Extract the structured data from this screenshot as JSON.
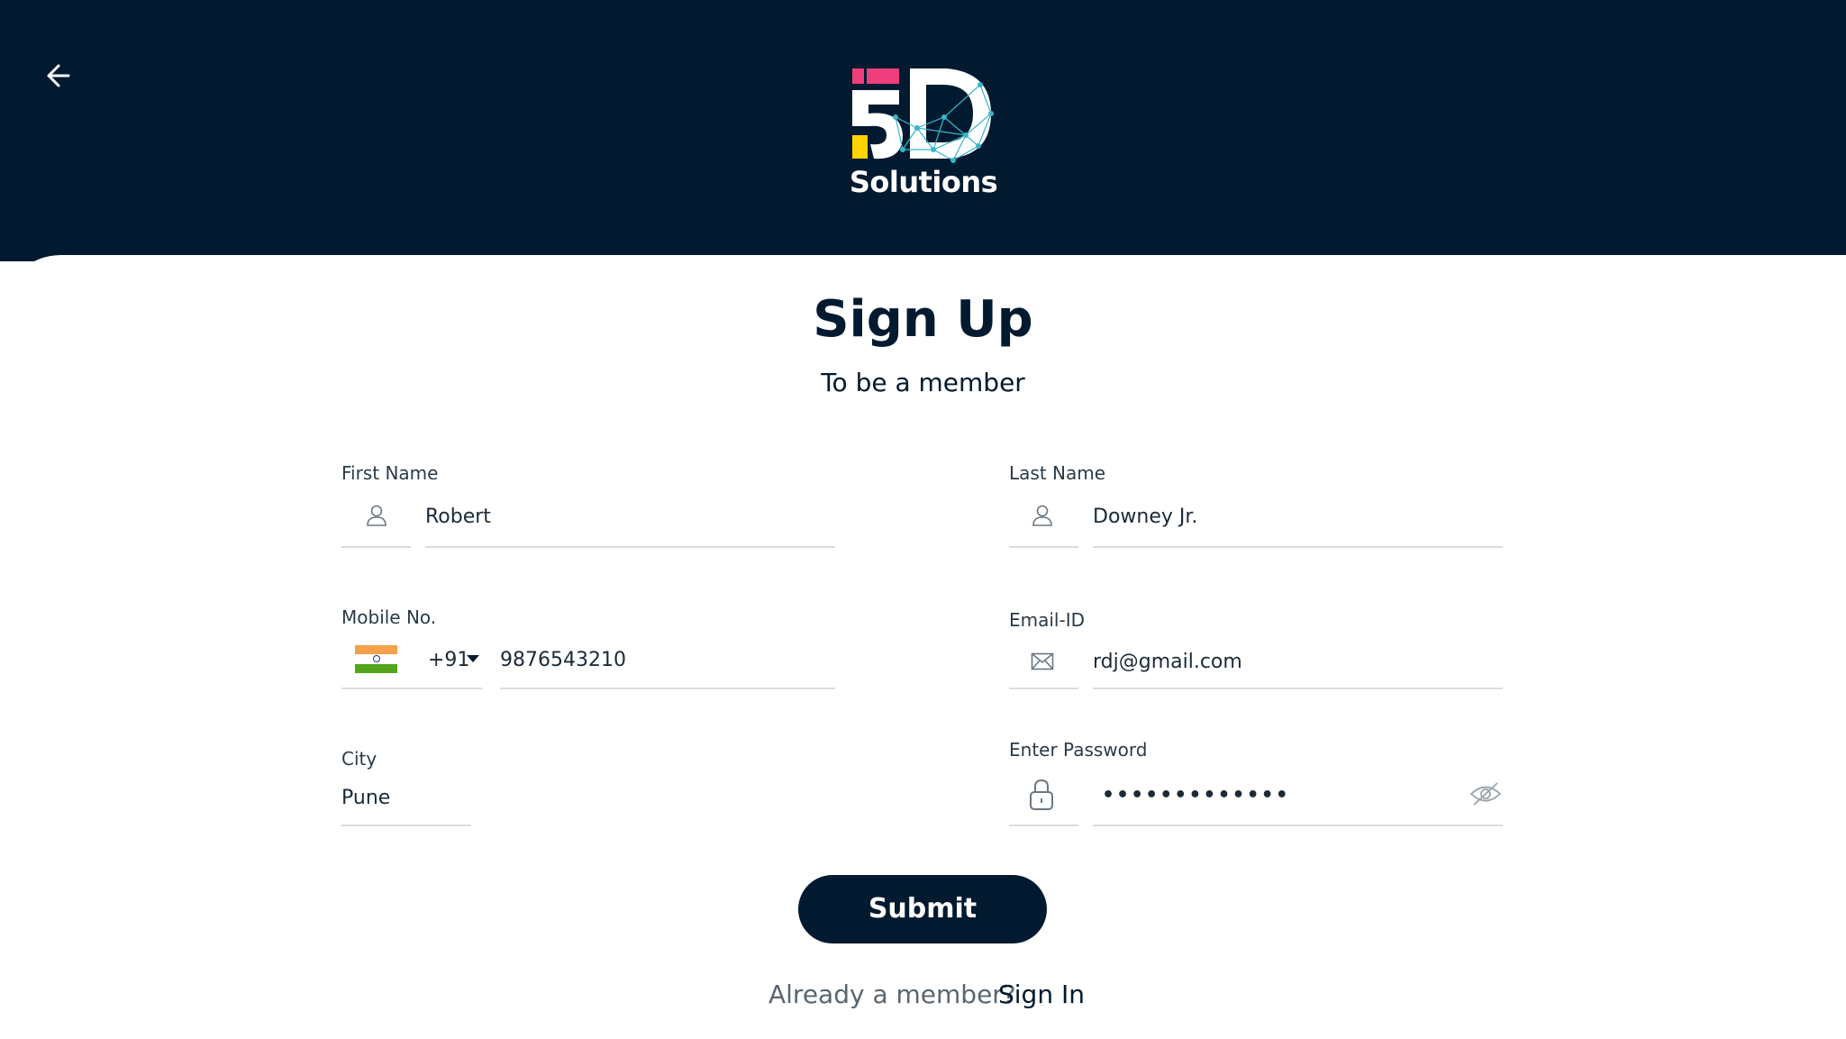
{
  "header": {
    "back_icon": "arrow-left-icon",
    "logo_text": "Solutions",
    "colors": {
      "background": "#021a30",
      "logo_pink": "#ee3f7c",
      "logo_yellow": "#ffd400",
      "logo_network": "#38b6c9"
    }
  },
  "page": {
    "title": "Sign Up",
    "subtitle": "To be a member"
  },
  "form": {
    "first_name": {
      "label": "First Name",
      "value": "Robert",
      "icon": "user-icon"
    },
    "last_name": {
      "label": "Last Name",
      "value": "Downey Jr.",
      "icon": "user-icon"
    },
    "mobile": {
      "label": "Mobile No.",
      "country_code": "+91",
      "flag": "india-flag",
      "value": "9876543210"
    },
    "email": {
      "label": "Email-ID",
      "value": "rdj@gmail.com",
      "icon": "mail-icon"
    },
    "city": {
      "label": "City",
      "value": "Pune"
    },
    "password": {
      "label": "Enter Password",
      "masked_value": "•••••••••••••",
      "icon": "lock-icon",
      "toggle_icon": "eye-off-icon"
    }
  },
  "actions": {
    "submit_label": "Submit",
    "already_member_text": "Already a member?",
    "sign_in_label": "Sign In",
    "button_color": "#021a30"
  }
}
